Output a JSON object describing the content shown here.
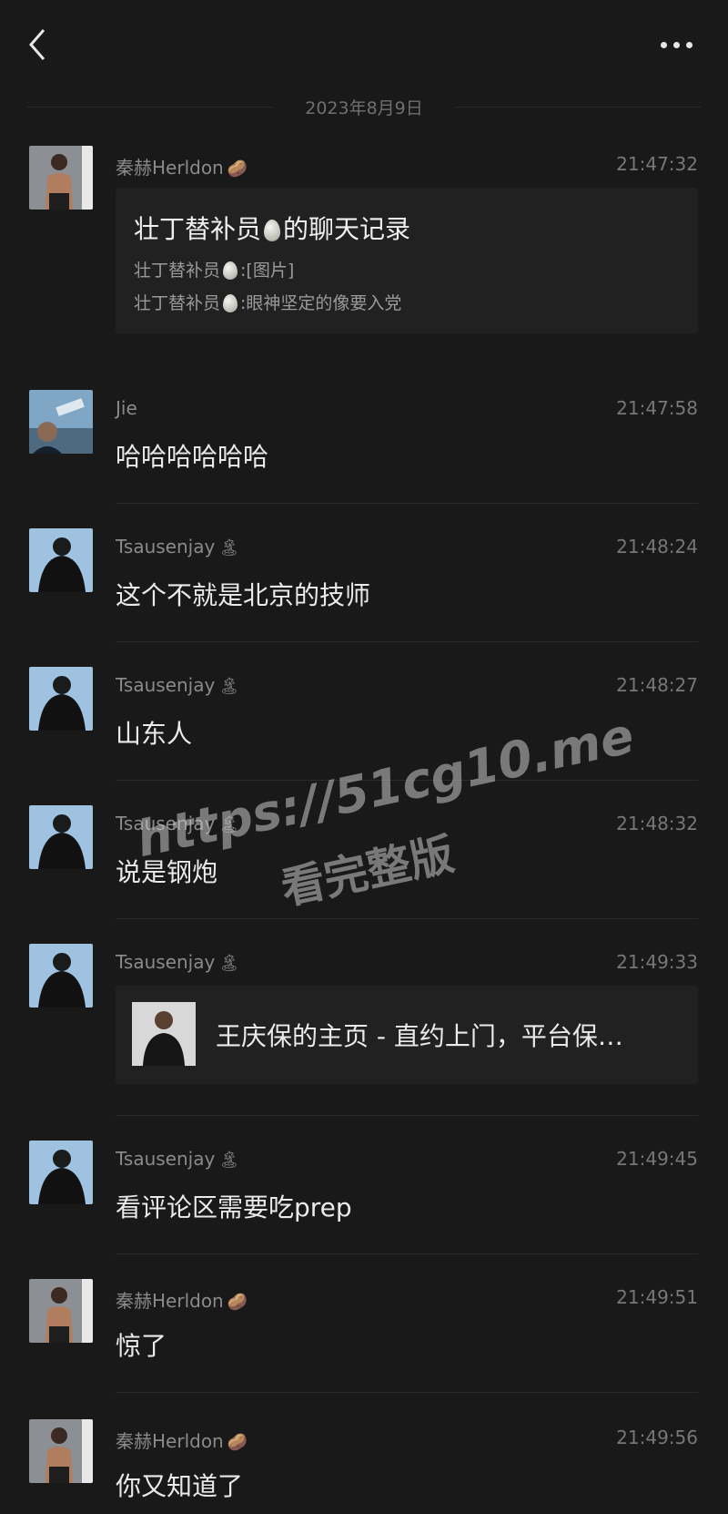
{
  "header": {
    "back_icon": "chevron-left-icon",
    "more_icon": "more-dots-icon"
  },
  "date_divider": "2023年8月9日",
  "messages": [
    {
      "sender": "秦赫Herldon",
      "sender_emoji": "🥔",
      "time": "21:47:32",
      "type": "chat-record",
      "card": {
        "title_prefix": "壮丁替补员",
        "title_suffix": "的聊天记录",
        "line1_name": "壮丁替补员",
        "line1_text": ":[图片]",
        "line2_name": "壮丁替补员",
        "line2_text": ":眼神坚定的像要入党"
      }
    },
    {
      "sender": "Jie",
      "sender_emoji": "",
      "time": "21:47:58",
      "type": "text",
      "text": "哈哈哈哈哈哈"
    },
    {
      "sender": "Tsausenjay",
      "sender_emoji": "🏝",
      "time": "21:48:24",
      "type": "text",
      "text": "这个不就是北京的技师"
    },
    {
      "sender": "Tsausenjay",
      "sender_emoji": "🏝",
      "time": "21:48:27",
      "type": "text",
      "text": "山东人"
    },
    {
      "sender": "Tsausenjay",
      "sender_emoji": "🏝",
      "time": "21:48:32",
      "type": "text",
      "text": "说是钢炮"
    },
    {
      "sender": "Tsausenjay",
      "sender_emoji": "🏝",
      "time": "21:49:33",
      "type": "link",
      "link_title": "王庆保的主页 - 直约上门，平台保…"
    },
    {
      "sender": "Tsausenjay",
      "sender_emoji": "🏝",
      "time": "21:49:45",
      "type": "text",
      "text": "看评论区需要吃prep"
    },
    {
      "sender": "秦赫Herldon",
      "sender_emoji": "🥔",
      "time": "21:49:51",
      "type": "text",
      "text": "惊了"
    },
    {
      "sender": "秦赫Herldon",
      "sender_emoji": "🥔",
      "time": "21:49:56",
      "type": "text",
      "text": "你又知道了"
    }
  ],
  "watermark": {
    "url": "https://51cg10.me",
    "sub": "看完整版"
  },
  "colors": {
    "background": "#191919",
    "card": "#212121",
    "time": "#777777",
    "text": "#eaeaea"
  }
}
